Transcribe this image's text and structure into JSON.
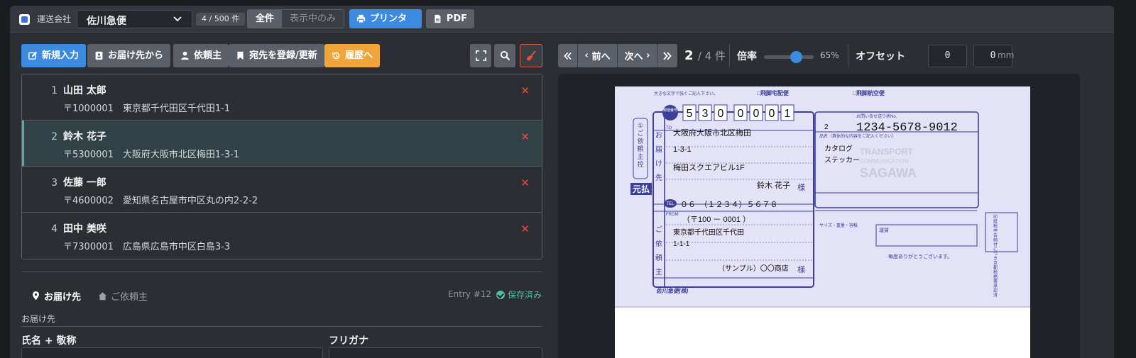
{
  "topbar": {
    "carrier_label": "運送会社",
    "carrier_value": "佐川急便",
    "count": "4 / 500 件",
    "filter_all": "全件",
    "filter_visible": "表示中のみ",
    "print_label": "プリンタ",
    "pdf_label": "PDF"
  },
  "toolbar": {
    "new_label": "新規入力",
    "from_dest_label": "お届け先から",
    "requester_label": "依頼主",
    "register_label": "宛先を登録/更新",
    "history_label": "履歴へ"
  },
  "entries": [
    {
      "num": "1",
      "name": "山田 太郎",
      "address": "〒1000001　東京都千代田区千代田1-1"
    },
    {
      "num": "2",
      "name": "鈴木 花子",
      "address": "〒5300001　大阪府大阪市北区梅田1-3-1"
    },
    {
      "num": "3",
      "name": "佐藤 一郎",
      "address": "〒4600002　愛知県名古屋市中区丸の内2-2-2"
    },
    {
      "num": "4",
      "name": "田中 美咲",
      "address": "〒7300001　広島県広島市中区白島3-3"
    }
  ],
  "form": {
    "tab_destination": "お届け先",
    "tab_requester": "ご依頼主",
    "entry_id": "Entry #12",
    "saved_label": "保存済み",
    "section_title": "お届け先",
    "name_label": "氏名 + 敬称",
    "kana_label": "フリガナ"
  },
  "viewer": {
    "prev_label": "前へ",
    "next_label": "次へ",
    "current_page": "2",
    "total_pages": "/ 4 件",
    "zoom_label": "倍率",
    "zoom_percent": 65,
    "zoom_value": "65%",
    "offset_label": "オフセット",
    "offset_x": "0",
    "offset_y": "0",
    "offset_unit": "mm"
  },
  "slip": {
    "postal_digits": [
      "5",
      "3",
      "0",
      "0",
      "0",
      "0",
      "1"
    ],
    "parcel_count": "2",
    "tracking": "1234-5678-9012",
    "to_address_1": "大阪府大阪市北区梅田",
    "to_address_2": "1-3-1",
    "to_address_3": "梅田スクエアビル1F",
    "to_name": "鈴木 花子",
    "honorific": "様",
    "to_tel": "０６　（１２３４）５６７８",
    "item_1": "カタログ",
    "item_2": "ステッカー",
    "from_postal": "（〒100 － 0001 ）",
    "from_address_1": "東京都千代田区千代田",
    "from_address_2": "1-1-1",
    "from_name": "（サンプル）〇〇商店",
    "to_vertical": "お届け先",
    "from_vertical": "ご依頼主",
    "request_vertical": "①ご依頼主控",
    "motobarai": "元払",
    "header_text": "大きな文字で強くご記入下さい。",
    "service_1": "□飛脚宅配便",
    "service_2": "□飛脚航空便",
    "inquiry_label": "お問い合せ送り状No.",
    "item_label": "品名（具体的な内容をご記入ください）",
    "watermark_1": "TRANSPORT",
    "watermark_2": "COMMUNICATION",
    "watermark_3": "SAGAWA",
    "carrier_name": "佐川急便(株)",
    "thanks": "毎度ありがとうございます。",
    "to_label": "TO",
    "from_label": "FROM",
    "tel_label": "TEL",
    "postal_label": "郵便番号",
    "fare_label": "運賃",
    "size_label": "サイズ・重量・容積",
    "tax_stamp": "印紙税申告納付につき京都税務署承認済"
  }
}
